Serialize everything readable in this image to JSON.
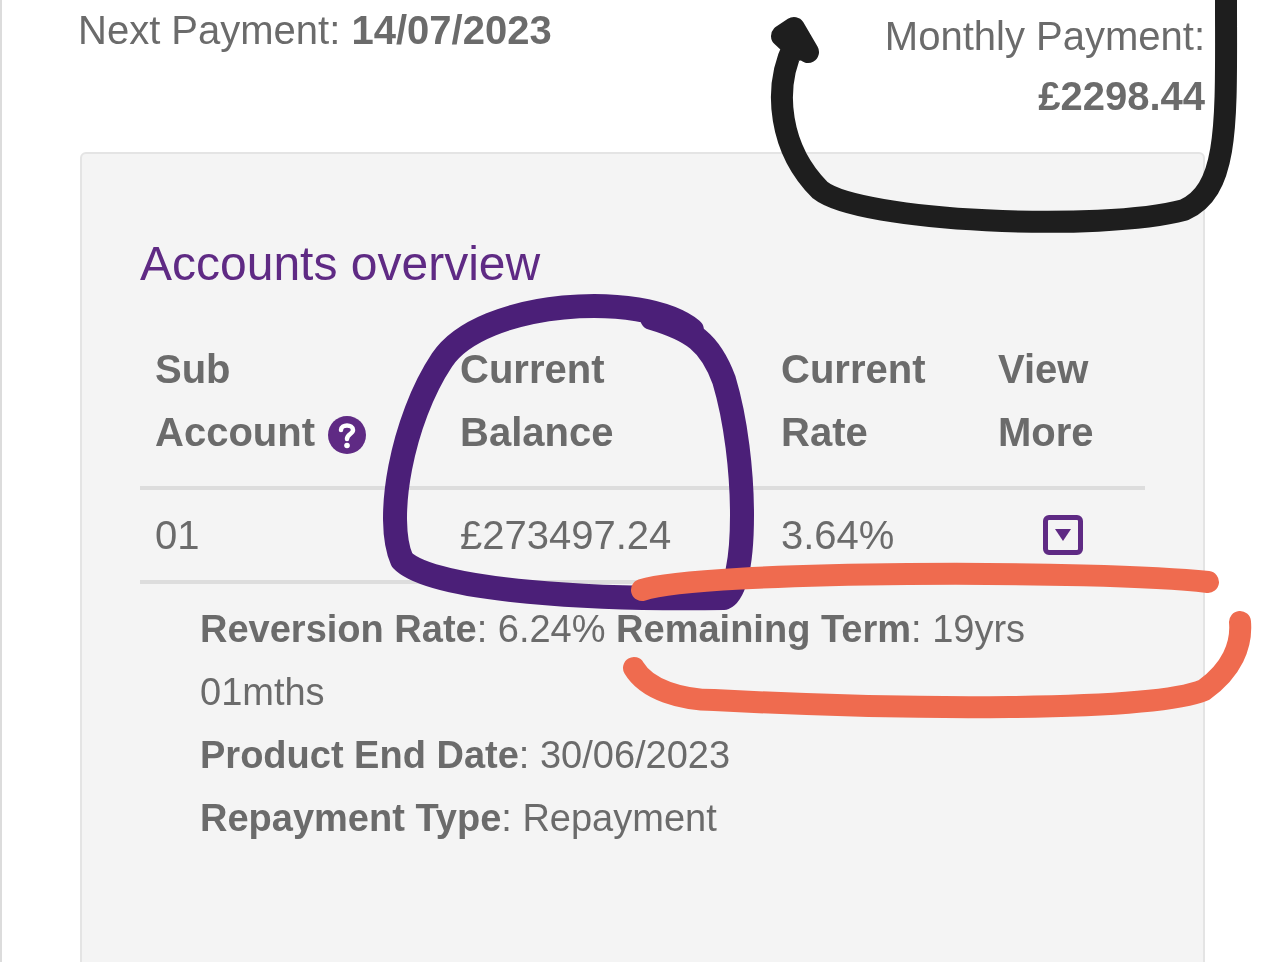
{
  "next_payment": {
    "label": "Next Payment:",
    "value": "14/07/2023"
  },
  "monthly_payment": {
    "label": "Monthly Payment:",
    "value": "£2298.44"
  },
  "accounts_overview": {
    "title": "Accounts overview",
    "columns": [
      {
        "lines": [
          "Sub",
          "Account"
        ],
        "help": true
      },
      {
        "lines": [
          "Current",
          "Balance"
        ],
        "help": false
      },
      {
        "lines": [
          "Current",
          "Rate"
        ],
        "help": false
      },
      {
        "lines": [
          "View",
          "More"
        ],
        "help": false
      }
    ],
    "rows": [
      {
        "sub_account": "01",
        "current_balance": "£273497.24",
        "current_rate": "3.64%",
        "expanded": true,
        "details": [
          "**Reversion Rate**: 6.24% **Remaining Term**: 19yrs 01mths",
          "**Product End Date**: 30/06/2023",
          "**Repayment Type**: Repayment"
        ]
      }
    ]
  },
  "annotations": [
    {
      "color": "#1e1e1e"
    },
    {
      "color": "#4b1f78"
    },
    {
      "color": "#ef6b4f"
    }
  ]
}
